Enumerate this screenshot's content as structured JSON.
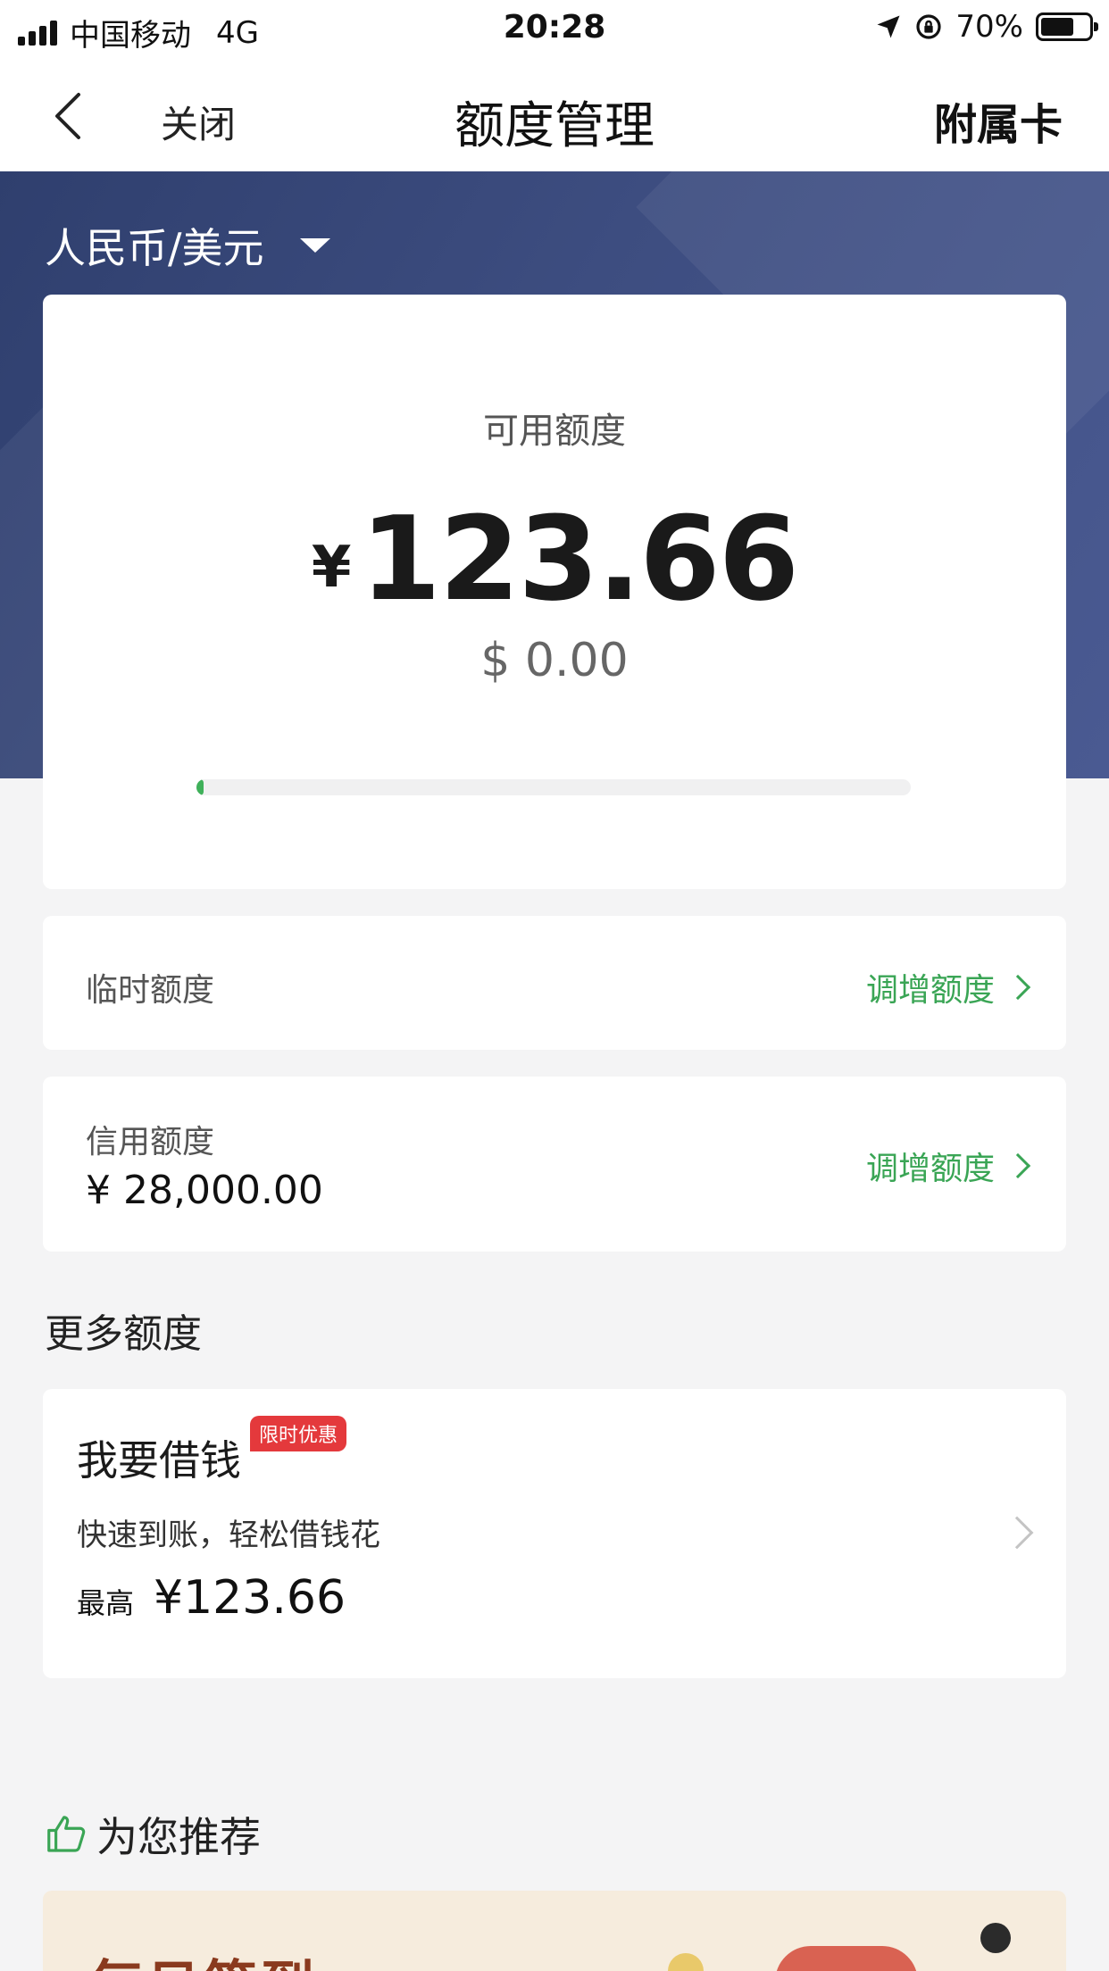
{
  "status_bar": {
    "carrier": "中国移动",
    "network": "4G",
    "time": "20:28",
    "battery": "70%",
    "battery_level": 0.7
  },
  "nav": {
    "close_label": "关闭",
    "title": "额度管理",
    "right_label": "附属卡"
  },
  "currency_selector": {
    "value": "人民币/美元"
  },
  "available": {
    "label": "可用额度",
    "currency_symbol": "¥",
    "amount": "123.66",
    "usd_amount": "$ 0.00",
    "progress": 0.01
  },
  "temporary": {
    "label": "临时额度",
    "link": "调增额度"
  },
  "credit": {
    "label": "信用额度",
    "amount": "¥ 28,000.00",
    "link": "调增额度"
  },
  "more_section": {
    "title": "更多额度"
  },
  "loan": {
    "title": "我要借钱",
    "badge": "限时优惠",
    "description": "快速到账，轻松借钱花",
    "max_label": "最高",
    "max_amount": "¥123.66"
  },
  "recommend": {
    "title": "为您推荐",
    "banner_text": "每日签到"
  },
  "colors": {
    "accent_green": "#3aa555",
    "header_blue": "#3d4d80",
    "badge_red": "#e4393c"
  }
}
